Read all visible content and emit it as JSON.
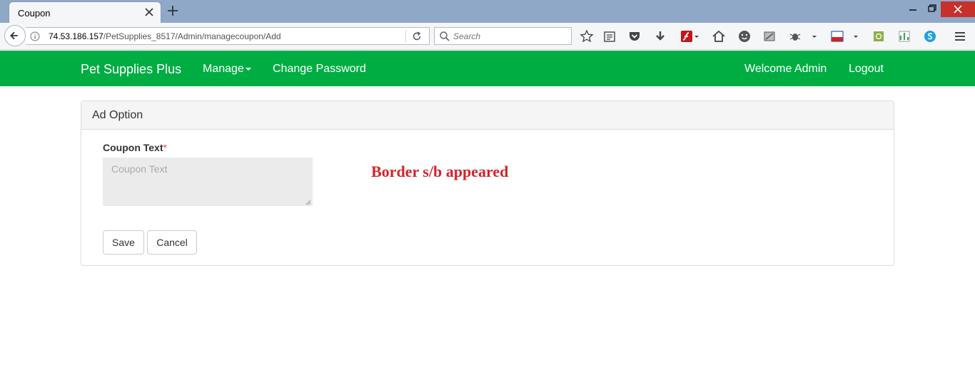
{
  "browser": {
    "tab_title": "Coupon",
    "url_host": "74.53.186.157",
    "url_path": "/PetSupplies_8517/Admin/managecoupon/Add",
    "search_placeholder": "Search"
  },
  "header": {
    "brand": "Pet Supplies Plus",
    "manage_label": "Manage",
    "change_password_label": "Change Password",
    "welcome_text": "Welcome Admin",
    "logout_label": "Logout",
    "bg_color": "#00ad43"
  },
  "panel": {
    "title": "Ad Option",
    "coupon_label": "Coupon Text",
    "required_marker": "*",
    "coupon_placeholder": "Coupon Text",
    "coupon_value": "",
    "save_label": "Save",
    "cancel_label": "Cancel"
  },
  "annotation": {
    "text": "Border s/b appeared",
    "color": "#d3242b"
  },
  "toolbar_icons": [
    "bookmark-star-icon",
    "reading-list-icon",
    "pocket-icon",
    "download-icon",
    "flash-icon",
    "home-icon",
    "smiley-icon",
    "screenshot-icon",
    "bug-icon",
    "new-badge-icon",
    "addon-green-icon",
    "addon-chart-icon",
    "skype-icon",
    "menu-icon"
  ]
}
